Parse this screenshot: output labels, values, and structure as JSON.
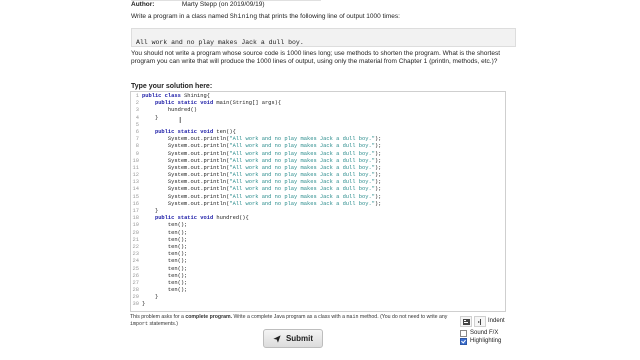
{
  "header": {
    "author_label": "Author:",
    "author_value": "Marty Stepp (on 2019/09/19)"
  },
  "problem": {
    "prompt_before": "Write a program in a class named ",
    "class_name": "Shining",
    "prompt_after": " that prints the following line of output 1000 times:",
    "expected_output": "All work and no play makes Jack a dull boy.",
    "question": "You should not write a program whose source code is 1000 lines long; use methods to shorten the program. What is the shortest program you can write that will produce the 1000 lines of output, using only the material from Chapter 1 (println, methods, etc.)?"
  },
  "editor": {
    "label": "Type your solution here:",
    "lines": [
      {
        "n": "1",
        "parts": [
          [
            "kw",
            "public class "
          ],
          [
            "t",
            "Shining{"
          ]
        ]
      },
      {
        "n": "2",
        "parts": [
          [
            "t",
            "    "
          ],
          [
            "kw",
            "public static void "
          ],
          [
            "t",
            "main(String[] args){"
          ]
        ]
      },
      {
        "n": "3",
        "parts": [
          [
            "t",
            "        hundred()"
          ]
        ]
      },
      {
        "n": "4",
        "parts": [
          [
            "t",
            "    }"
          ]
        ]
      },
      {
        "n": "5",
        "parts": []
      },
      {
        "n": "6",
        "parts": [
          [
            "t",
            "    "
          ],
          [
            "kw",
            "public static void "
          ],
          [
            "t",
            "ten(){"
          ]
        ]
      },
      {
        "n": "7",
        "parts": [
          [
            "t",
            "        System.out.println("
          ],
          [
            "str",
            "\"All work and no play makes Jack a dull boy.\""
          ],
          [
            "t",
            ");"
          ]
        ]
      },
      {
        "n": "8",
        "parts": [
          [
            "t",
            "        System.out.println("
          ],
          [
            "str",
            "\"All work and no play makes Jack a dull boy.\""
          ],
          [
            "t",
            ");"
          ]
        ]
      },
      {
        "n": "9",
        "parts": [
          [
            "t",
            "        System.out.println("
          ],
          [
            "str",
            "\"All work and no play makes Jack a dull boy.\""
          ],
          [
            "t",
            ");"
          ]
        ]
      },
      {
        "n": "10",
        "parts": [
          [
            "t",
            "        System.out.println("
          ],
          [
            "str",
            "\"All work and no play makes Jack a dull boy.\""
          ],
          [
            "t",
            ");"
          ]
        ]
      },
      {
        "n": "11",
        "parts": [
          [
            "t",
            "        System.out.println("
          ],
          [
            "str",
            "\"All work and no play makes Jack a dull boy.\""
          ],
          [
            "t",
            ");"
          ]
        ]
      },
      {
        "n": "12",
        "parts": [
          [
            "t",
            "        System.out.println("
          ],
          [
            "str",
            "\"All work and no play makes Jack a dull boy.\""
          ],
          [
            "t",
            ");"
          ]
        ]
      },
      {
        "n": "13",
        "parts": [
          [
            "t",
            "        System.out.println("
          ],
          [
            "str",
            "\"All work and no play makes Jack a dull boy.\""
          ],
          [
            "t",
            ");"
          ]
        ]
      },
      {
        "n": "14",
        "parts": [
          [
            "t",
            "        System.out.println("
          ],
          [
            "str",
            "\"All work and no play makes Jack a dull boy.\""
          ],
          [
            "t",
            ");"
          ]
        ]
      },
      {
        "n": "15",
        "parts": [
          [
            "t",
            "        System.out.println("
          ],
          [
            "str",
            "\"All work and no play makes Jack a dull boy.\""
          ],
          [
            "t",
            ");"
          ]
        ]
      },
      {
        "n": "16",
        "parts": [
          [
            "t",
            "        System.out.println("
          ],
          [
            "str",
            "\"All work and no play makes Jack a dull boy.\""
          ],
          [
            "t",
            ");"
          ]
        ]
      },
      {
        "n": "17",
        "parts": [
          [
            "t",
            "    }"
          ]
        ]
      },
      {
        "n": "18",
        "parts": [
          [
            "t",
            "    "
          ],
          [
            "kw",
            "public static void "
          ],
          [
            "t",
            "hundred(){"
          ]
        ]
      },
      {
        "n": "19",
        "parts": [
          [
            "t",
            "        ten();"
          ]
        ]
      },
      {
        "n": "20",
        "parts": [
          [
            "t",
            "        ten();"
          ]
        ]
      },
      {
        "n": "21",
        "parts": [
          [
            "t",
            "        ten();"
          ]
        ]
      },
      {
        "n": "22",
        "parts": [
          [
            "t",
            "        ten();"
          ]
        ]
      },
      {
        "n": "23",
        "parts": [
          [
            "t",
            "        ten();"
          ]
        ]
      },
      {
        "n": "24",
        "parts": [
          [
            "t",
            "        ten();"
          ]
        ]
      },
      {
        "n": "25",
        "parts": [
          [
            "t",
            "        ten();"
          ]
        ]
      },
      {
        "n": "26",
        "parts": [
          [
            "t",
            "        ten();"
          ]
        ]
      },
      {
        "n": "27",
        "parts": [
          [
            "t",
            "        ten();"
          ]
        ]
      },
      {
        "n": "28",
        "parts": [
          [
            "t",
            "        ten();"
          ]
        ]
      },
      {
        "n": "29",
        "parts": [
          [
            "t",
            "    }"
          ]
        ]
      },
      {
        "n": "30",
        "parts": [
          [
            "t",
            "}"
          ]
        ]
      }
    ]
  },
  "footer": {
    "note_1": "This problem asks for a ",
    "note_bold": "complete program.",
    "note_2": " Write a complete Java program as a class with a ",
    "note_code_main": "main",
    "note_3": " method. (You do not need to write any ",
    "note_code_import": "import",
    "note_4": " statements.)",
    "submit_label": "Submit",
    "indent_label": "Indent",
    "sound_fx_label": "Sound F/X",
    "sound_fx_checked": false,
    "highlighting_label": "Highlighting",
    "highlighting_checked": true
  },
  "colors": {
    "keyword": "#1a1aa6",
    "string": "#2a8c8c",
    "accent": "#3b6fd1"
  }
}
